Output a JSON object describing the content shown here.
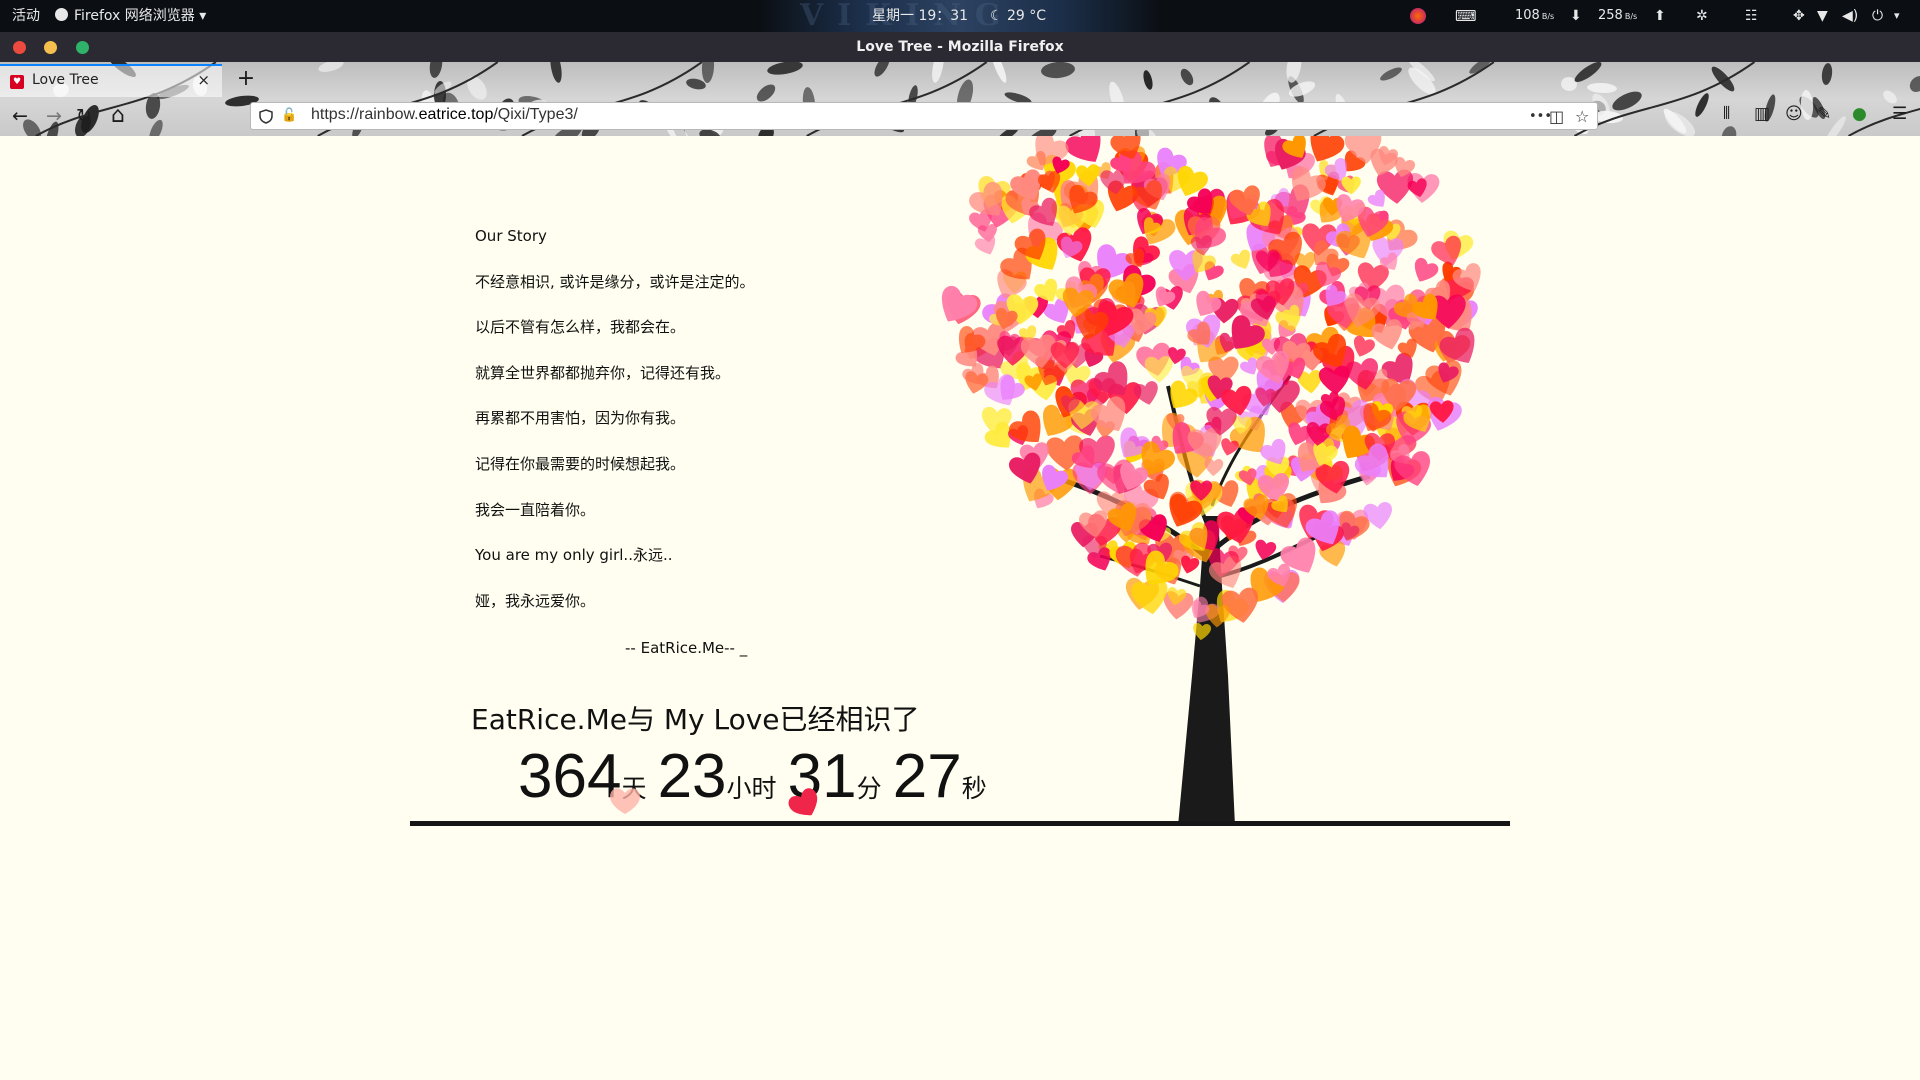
{
  "topbar": {
    "activities": "活动",
    "app_name": "Firefox 网络浏览器",
    "clock": "星期一 19：31",
    "weather": "29 °C",
    "net_down": "108",
    "net_down_unit": "B/s",
    "net_up": "258",
    "net_up_unit": "B/s",
    "accent": "#0b0f14"
  },
  "window": {
    "title": "Love Tree - Mozilla Firefox",
    "close_color": "#ed4a3f",
    "minimize_color": "#f4bf4f",
    "maximize_color": "#2fb36a"
  },
  "tab": {
    "title": "Love Tree",
    "close": "×",
    "new_tab": "+"
  },
  "nav": {
    "back": "←",
    "forward": "→",
    "reload": "↻",
    "home": "⌂"
  },
  "urlbar": {
    "scheme": "https://rainbow.",
    "domain": "eatrice.top",
    "path": "/Qixi/Type3/",
    "page_actions": "•••",
    "pocket": "◫",
    "bookmark": "☆"
  },
  "story": {
    "lines": [
      "Our Story",
      "不经意相识, 或许是缘分，或许是注定的。",
      "以后不管有怎么样，我都会在。",
      "就算全世界都都抛弃你，记得还有我。",
      "再累都不用害怕，因为你有我。",
      "记得在你最需要的时候想起我。",
      "我会一直陪着你。",
      "You are my only girl..永远..",
      "娅，我永远爱你。"
    ],
    "signature": "-- EatRice.Me-- _"
  },
  "counter": {
    "title": "EatRice.Me与 My Love已经相识了",
    "days": "364",
    "days_unit": "天",
    "hours": "23",
    "hours_unit": "小时",
    "minutes": "31",
    "minutes_unit": "分",
    "seconds": "27",
    "seconds_unit": "秒"
  },
  "colors": {
    "page_bg": "#fffef0",
    "heart_palette": [
      "#ff1744",
      "#ff4081",
      "#ff80ab",
      "#e91e63",
      "#ff9800",
      "#ffd600",
      "#ffeb3b",
      "#f50057",
      "#ff6e40",
      "#ff8a80",
      "#ea80fc",
      "#ff3d00"
    ],
    "trunk": "#1a1a1a"
  }
}
